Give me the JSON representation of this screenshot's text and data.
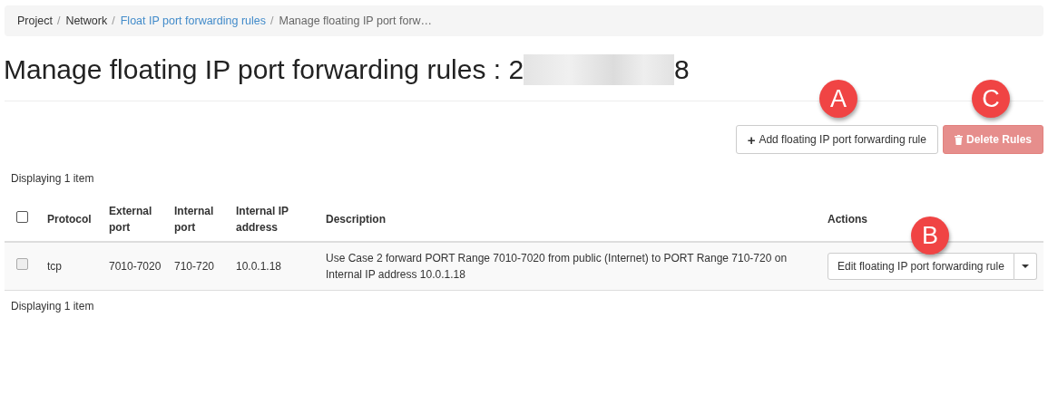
{
  "breadcrumb_separator": "/",
  "breadcrumb": [
    {
      "label": "Project",
      "kind": "text"
    },
    {
      "label": "Network",
      "kind": "text"
    },
    {
      "label": "Float IP port forwarding rules",
      "kind": "link"
    },
    {
      "label": "Manage floating IP port forw…",
      "kind": "current"
    }
  ],
  "page_title": {
    "prefix": "Manage floating IP port forwarding rules : 2",
    "suffix": "8"
  },
  "toolbar": {
    "add_button": {
      "icon": "+",
      "label": "Add floating IP port forwarding rule"
    },
    "delete_button": {
      "label": "Delete Rules",
      "disabled": true
    }
  },
  "item_count_top": "Displaying 1 item",
  "table": {
    "select_all": {
      "checked": false
    },
    "columns": [
      "Protocol",
      "External port",
      "Internal port",
      "Internal IP address",
      "Description",
      "Actions"
    ],
    "rows": [
      {
        "checked": false,
        "cells": [
          "tcp",
          "7010-7020",
          "710-720",
          "10.0.1.18",
          "Use Case 2 forward PORT Range 7010-7020 from public (Internet) to PORT Range 710-720 on Internal IP address 10.0.1.18"
        ],
        "action": "Edit floating IP port forwarding rule"
      }
    ]
  },
  "item_count_bottom": "Displaying 1 item",
  "markers": [
    "A",
    "C",
    "B"
  ]
}
